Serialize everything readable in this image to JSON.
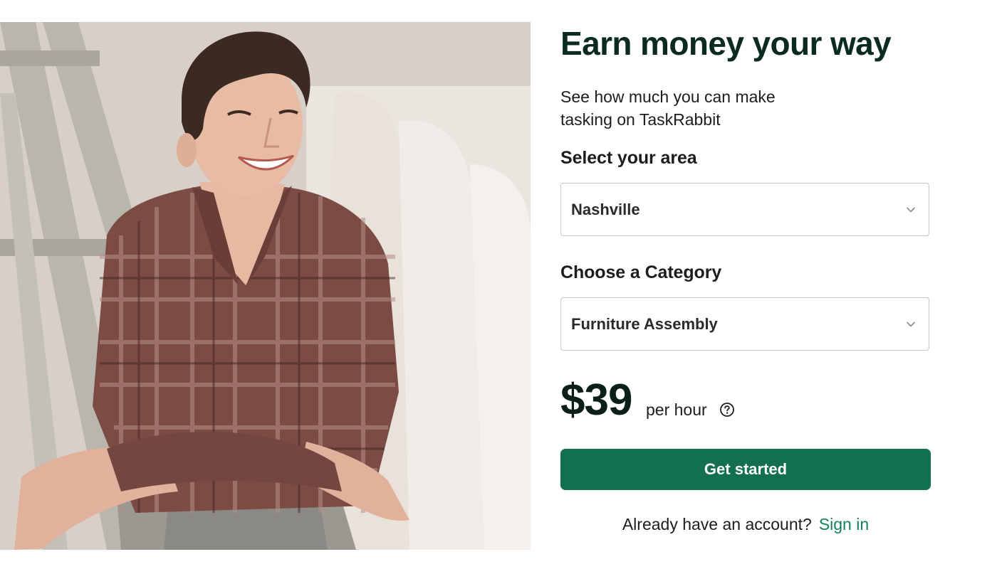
{
  "hero": {
    "image": "person-in-plaid-shirt-photo"
  },
  "form": {
    "title": "Earn money your way",
    "subtitle": "See how much you can make tasking on TaskRabbit",
    "area": {
      "label": "Select your area",
      "value": "Nashville",
      "icon": "chevron-down-icon"
    },
    "category": {
      "label": "Choose a Category",
      "value": "Furniture Assembly",
      "icon": "chevron-down-icon"
    },
    "rate": {
      "amount": "$39",
      "unit": "per hour",
      "icon": "help-circle-icon"
    },
    "cta_label": "Get started",
    "account_prompt": "Already have an account?",
    "signin_label": "Sign in"
  },
  "colors": {
    "accent": "#13704f",
    "link": "#13825b",
    "title": "#0b2a22"
  }
}
